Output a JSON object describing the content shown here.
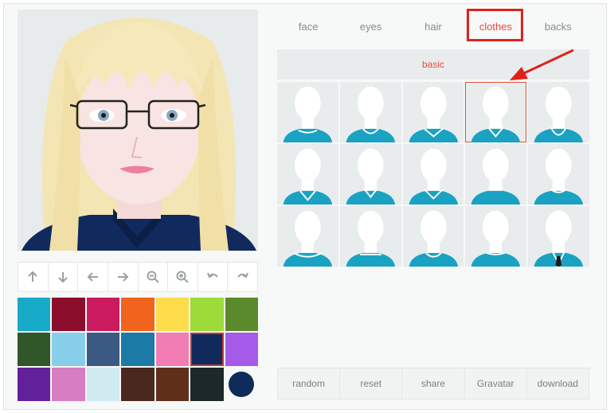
{
  "tabs": [
    {
      "label": "face",
      "active": false
    },
    {
      "label": "eyes",
      "active": false
    },
    {
      "label": "hair",
      "active": false
    },
    {
      "label": "clothes",
      "active": true
    },
    {
      "label": "backs",
      "active": false
    }
  ],
  "section": {
    "label": "basic"
  },
  "toolbar": {
    "icons": [
      "arrow-up-icon",
      "arrow-down-icon",
      "arrow-left-icon",
      "arrow-right-icon",
      "zoom-out-icon",
      "zoom-in-icon",
      "undo-icon",
      "redo-icon"
    ]
  },
  "palette": {
    "colors": [
      "#17aac9",
      "#8b0e2c",
      "#cc1a5e",
      "#f0641d",
      "#fddc4c",
      "#9ddb3a",
      "#5b8a2c",
      "#2f5727",
      "#87ceea",
      "#3a5a83",
      "#1b7aa6",
      "#f27cb4",
      "#112a5e",
      "#a65be8",
      "#62219a",
      "#d77dc1",
      "#cfeaf0",
      "#4a2820",
      "#5f2f1a",
      "#1d282b"
    ],
    "selected_index": 12,
    "current_color": "#0f2b5a"
  },
  "clothes": {
    "selected_index": 3,
    "shirt_color": "#1aa2c3"
  },
  "actions": [
    {
      "label": "random"
    },
    {
      "label": "reset"
    },
    {
      "label": "share"
    },
    {
      "label": "Gravatar"
    },
    {
      "label": "download"
    }
  ],
  "colors": {
    "accent": "#e74c3c",
    "annotation": "#e0211b"
  }
}
